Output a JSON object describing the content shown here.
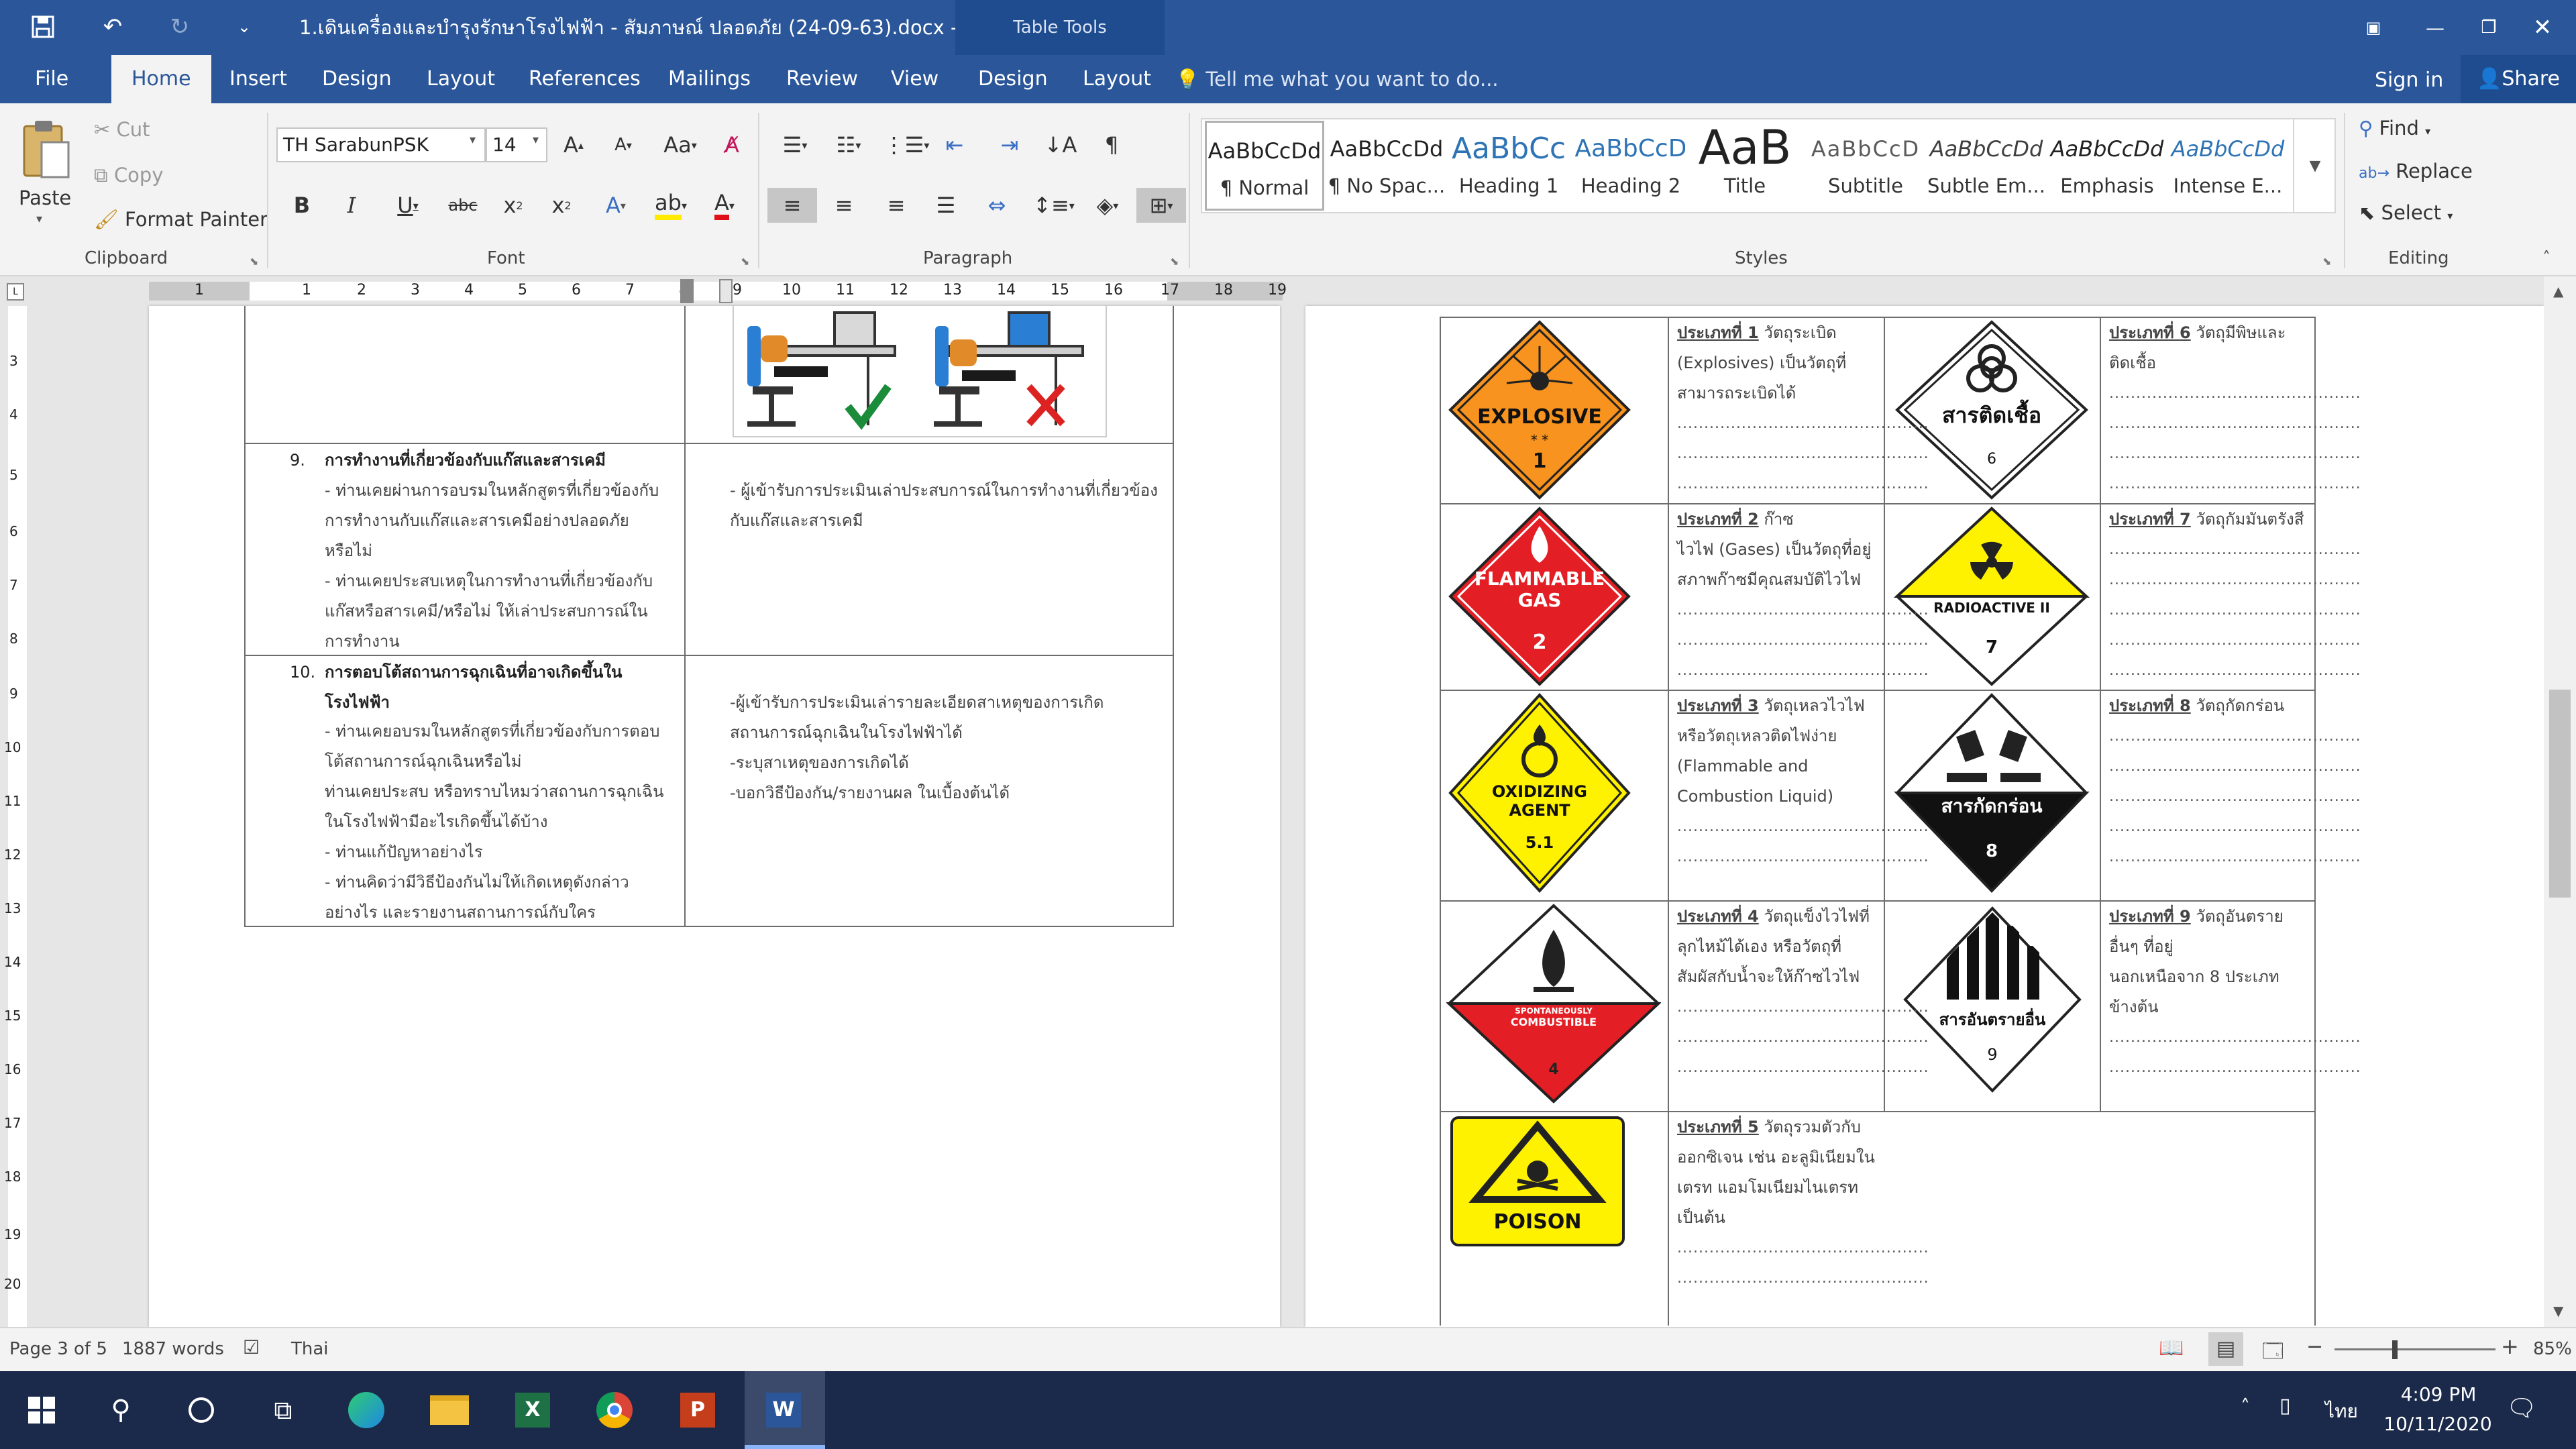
{
  "titlebar": {
    "doc_title": "1.เดินเครื่องและบำรุงรักษาโรงไฟฟ้า - สัมภาษณ์ ปลอดภัย (24-09-63).docx - Word",
    "table_tools": "Table Tools"
  },
  "tabs": [
    "File",
    "Home",
    "Insert",
    "Design",
    "Layout",
    "References",
    "Mailings",
    "Review",
    "View"
  ],
  "table_tabs": [
    "Design",
    "Layout"
  ],
  "tell_me": "Tell me what you want to do...",
  "signin": "Sign in",
  "share": "Share",
  "clipboard": {
    "paste": "Paste",
    "cut": "Cut",
    "copy": "Copy",
    "format_painter": "Format Painter",
    "label": "Clipboard"
  },
  "font": {
    "name": "TH SarabunPSK",
    "size": "14",
    "label": "Font"
  },
  "paragraph": {
    "label": "Paragraph"
  },
  "styles": {
    "label": "Styles",
    "items": [
      {
        "preview": "AaBbCcDd",
        "name": "¶ Normal",
        "color": "#000"
      },
      {
        "preview": "AaBbCcDd",
        "name": "¶ No Spac...",
        "color": "#000"
      },
      {
        "preview": "AaBbCc",
        "name": "Heading 1",
        "color": "#2e74b5"
      },
      {
        "preview": "AaBbCcD",
        "name": "Heading 2",
        "color": "#2e74b5"
      },
      {
        "preview": "AaB",
        "name": "Title",
        "color": "#000"
      },
      {
        "preview": "AaBbCcD",
        "name": "Subtitle",
        "color": "#5a5a5a"
      },
      {
        "preview": "AaBbCcDd",
        "name": "Subtle Em...",
        "color": "#404040"
      },
      {
        "preview": "AaBbCcDd",
        "name": "Emphasis",
        "color": "#000"
      },
      {
        "preview": "AaBbCcDd",
        "name": "Intense E...",
        "color": "#2e74b5"
      }
    ]
  },
  "editing": {
    "find": "Find",
    "replace": "Replace",
    "select": "Select",
    "label": "Editing"
  },
  "ruler_numbers": [
    "1",
    "1",
    "2",
    "3",
    "4",
    "5",
    "6",
    "7",
    "8",
    "9",
    "10",
    "11",
    "12",
    "13",
    "14",
    "15",
    "16",
    "17",
    "18",
    "19"
  ],
  "vruler_numbers": [
    "3",
    "4",
    "5",
    "6",
    "7",
    "8",
    "9",
    "10",
    "11",
    "12",
    "13",
    "14",
    "15",
    "16",
    "17",
    "18",
    "19",
    "20"
  ],
  "left_page": {
    "row9": {
      "num": "9.",
      "title": "การทำงานที่เกี่ยวข้องกับแก๊สและสารเคมี",
      "lines": [
        "- ท่านเคยผ่านการอบรมในหลักสูตรที่เกี่ยวข้องกับ",
        "การทำงานกับแก๊สและสารเคมีอย่างปลอดภัย",
        "หรือไม่",
        "- ท่านเคยประสบเหตุในการทำงานที่เกี่ยวข้องกับ",
        "แก๊สหรือสารเคมี/หรือไม่ ให้เล่าประสบการณ์ใน",
        "การทำงาน"
      ],
      "right": [
        "- ผู้เข้ารับการประเมินเล่าประสบการณ์ในการทำงานที่เกี่ยวข้อง",
        "กับแก๊สและสารเคมี"
      ]
    },
    "row10": {
      "num": "10.",
      "title1": "การตอบโต้สถานการฉุกเฉินที่อาจเกิดขึ้นใน",
      "title2": "โรงไฟฟ้า",
      "lines": [
        "- ท่านเคยอบรมในหลักสูตรที่เกี่ยวข้องกับการตอบ",
        "โต้สถานการณ์ฉุกเฉินหรือไม่",
        "ท่านเคยประสบ หรือทราบไหมว่าสถานการฉุกเฉิน",
        "ในโรงไฟฟ้ามีอะไรเกิดขึ้นได้บ้าง",
        "- ท่านแก้ปัญหาอย่างไร",
        "- ท่านคิดว่ามีวิธีป้องกันไม่ให้เกิดเหตุดังกล่าว",
        "อย่างไร และรายงานสถานการณ์กับใคร"
      ],
      "right": [
        "-ผู้เข้ารับการประเมินเล่ารายละเอียดสาเหตุของการเกิด",
        "สถานการณ์ฉุกเฉินในโรงไฟฟ้าได้",
        "-ระบุสาเหตุของการเกิดได้",
        "-บอกวิธีป้องกัน/รายงานผล ในเบื้องต้นได้"
      ]
    }
  },
  "right_page": {
    "dots": "...............................................",
    "class1": {
      "head": "ประเภทที่ 1",
      "rest": " วัตถุระเบิด",
      "lines": [
        "(Explosives) เป็นวัตถุที่",
        "สามารถระเบิดได้"
      ]
    },
    "class2": {
      "head": "ประเภทที่ 2",
      "rest": " ก๊าซ",
      "lines": [
        "ไวไฟ (Gases) เป็นวัตถุที่อยู่",
        "สภาพก๊าซมีคุณสมบัติไวไฟ"
      ]
    },
    "class3": {
      "head": "ประเภทที่ 3",
      "rest": " วัตถุเหลวไวไฟ",
      "lines": [
        "หรือวัตถุเหลวติดไฟง่าย",
        "(Flammable and",
        "Combustion Liquid)"
      ]
    },
    "class4": {
      "head": "ประเภทที่ 4",
      "rest": " วัตถุแข็งไวไฟที่",
      "lines": [
        "ลุกไหม้ได้เอง หรือวัตถุที่",
        "สัมผัสกับน้ำจะให้ก๊าซไวไฟ"
      ]
    },
    "class5": {
      "head": "ประเภทที่ 5",
      "rest": " วัตถุรวมตัวกับ",
      "lines": [
        "ออกซิเจน เช่น อะลูมิเนียมใน",
        "เตรท แอมโมเนียมไนเตรท",
        "เป็นต้น"
      ]
    },
    "class6": {
      "head": "ประเภทที่ 6",
      "rest": " วัตถุมีพิษและ",
      "lines": [
        "ติดเชื้อ"
      ]
    },
    "class7": {
      "head": "ประเภทที่ 7",
      "rest": " วัตถุกัมมันตรังสี",
      "lines": []
    },
    "class8": {
      "head": "ประเภทที่ 8",
      "rest": " วัตถุกัดกร่อน",
      "lines": []
    },
    "class9": {
      "head": "ประเภทที่ 9",
      "rest": " วัตถุอันตราย",
      "lines": [
        "อื่นๆ ที่อยู่",
        "นอกเหนือจาก 8 ประเภท",
        "ข้างต้น"
      ]
    },
    "signs": {
      "s1": "EXPLOSIVE",
      "s1n": "1",
      "s1s": "* *",
      "s2": "FLAMMABLE",
      "s2b": "GAS",
      "s2n": "2",
      "s3": "OXIDIZING",
      "s3b": "AGENT",
      "s3n": "5.1",
      "s4": "SPONTANEOUSLY",
      "s4b": "COMBUSTIBLE",
      "s4n": "4",
      "s5": "POISON",
      "s6": "สารติดเชื้อ",
      "s6n": "6",
      "s7": "RADIOACTIVE II",
      "s7n": "7",
      "s8": "สารกัดกร่อน",
      "s8n": "8",
      "s9": "สารอันตรายอื่น",
      "s9n": "9"
    }
  },
  "status": {
    "page": "Page 3 of 5",
    "words": "1887 words",
    "lang": "Thai",
    "zoom": "85%"
  },
  "taskbar": {
    "lang": "ไทย",
    "time": "4:09 PM",
    "date": "10/11/2020"
  }
}
